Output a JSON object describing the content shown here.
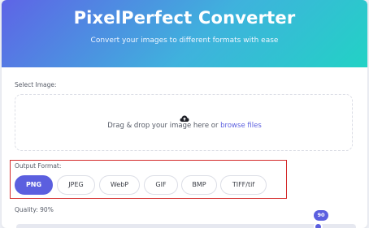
{
  "header": {
    "title": "PixelPerfect Converter",
    "subtitle": "Convert your images to different formats with ease"
  },
  "upload": {
    "label": "Select Image:",
    "icon": "cloud-upload-icon",
    "drop_text": "Drag & drop your image here or ",
    "browse_text": "browse files"
  },
  "format": {
    "label": "Output Format:",
    "selected": "PNG",
    "options": [
      "PNG",
      "JPEG",
      "WebP",
      "GIF",
      "BMP",
      "TIFF/tif"
    ]
  },
  "quality": {
    "label": "Quality: 90%",
    "value": 90,
    "max": 100
  },
  "colors": {
    "accent": "#5b5fdf",
    "header_start": "#5e64e6",
    "header_end": "#22d2c5",
    "highlight_border": "#d42a2a"
  }
}
